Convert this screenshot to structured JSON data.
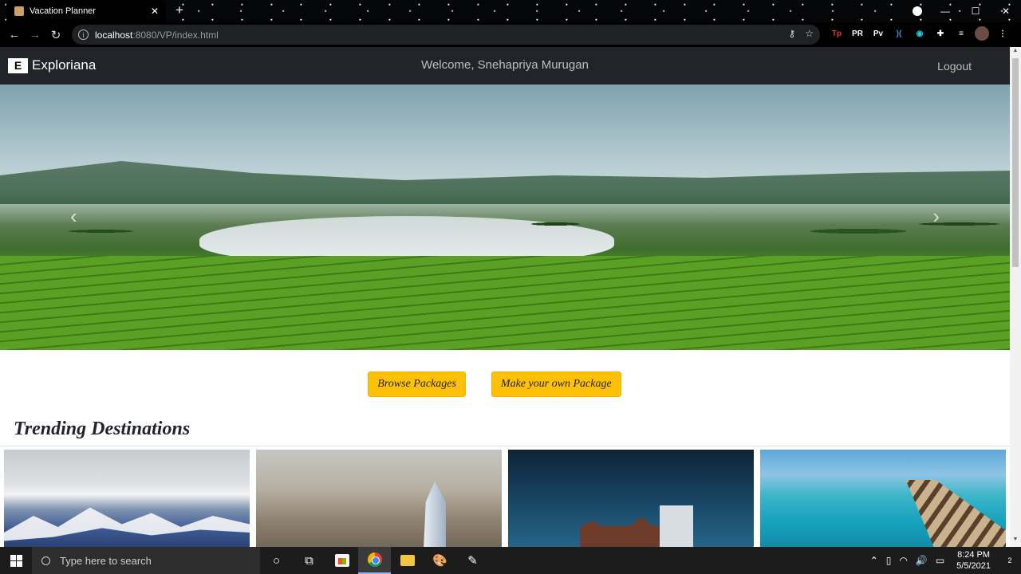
{
  "browser": {
    "tab_title": "Vacation Planner",
    "tab_close": "✕",
    "new_tab": "+",
    "url_host": "localhost",
    "url_rest": ":8080/VP/index.html",
    "window_controls": [
      "—",
      "☐",
      "✕"
    ]
  },
  "site": {
    "brand_logo": "E",
    "brand_name": "Exploriana",
    "welcome": "Welcome, Snehapriya Murugan",
    "logout": "Logout",
    "carousel_prev": "‹",
    "carousel_next": "›",
    "browse_button": "Browse Packages",
    "custom_button": "Make your own Package",
    "section_title": "Trending Destinations"
  },
  "taskbar": {
    "search_placeholder": "Type here to search",
    "time": "8:24 PM",
    "date": "5/5/2021",
    "notification_count": "2"
  }
}
